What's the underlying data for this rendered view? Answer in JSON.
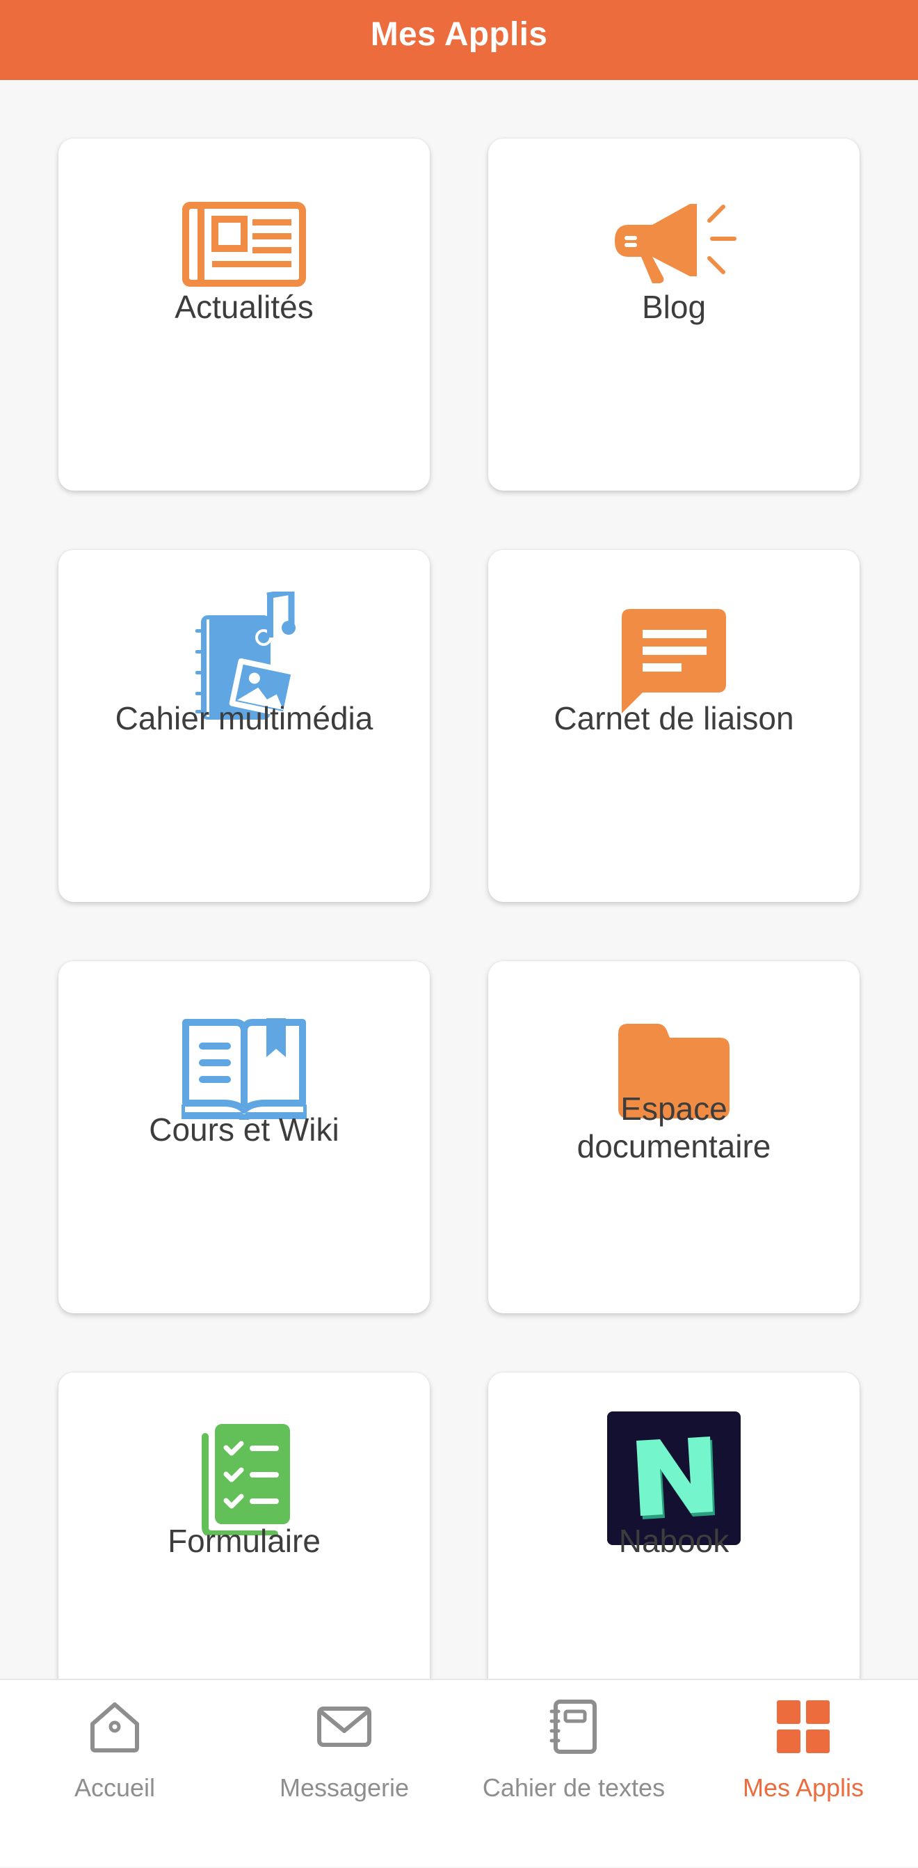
{
  "header": {
    "title": "Mes Applis"
  },
  "apps": [
    {
      "label": "Actualités",
      "icon": "newspaper-icon",
      "color": "#f08c44"
    },
    {
      "label": "Blog",
      "icon": "megaphone-icon",
      "color": "#f08c44"
    },
    {
      "label": "Cahier multimédia",
      "icon": "multimedia-notebook-icon",
      "color": "#5fa6e2"
    },
    {
      "label": "Carnet de liaison",
      "icon": "message-bubble-icon",
      "color": "#f08c44"
    },
    {
      "label": "Cours et Wiki",
      "icon": "open-book-icon",
      "color": "#5fa6e2"
    },
    {
      "label_line1": "Espace",
      "label_line2": "documentaire",
      "icon": "folder-icon",
      "color": "#f08c44"
    },
    {
      "label": "Formulaire",
      "icon": "checklist-icon",
      "color": "#63bf58"
    },
    {
      "label": "Nabook",
      "icon": "nabook-logo-icon",
      "color": "#74f5cc"
    }
  ],
  "tabbar": {
    "items": [
      {
        "label": "Accueil",
        "icon": "home-icon",
        "active": false
      },
      {
        "label": "Messagerie",
        "icon": "envelope-icon",
        "active": false
      },
      {
        "label": "Cahier de textes",
        "icon": "notebook-icon",
        "active": false
      },
      {
        "label": "Mes Applis",
        "icon": "apps-grid-icon",
        "active": true
      }
    ],
    "active_color": "#ec6c3d",
    "inactive_color": "#8e8e8e"
  }
}
